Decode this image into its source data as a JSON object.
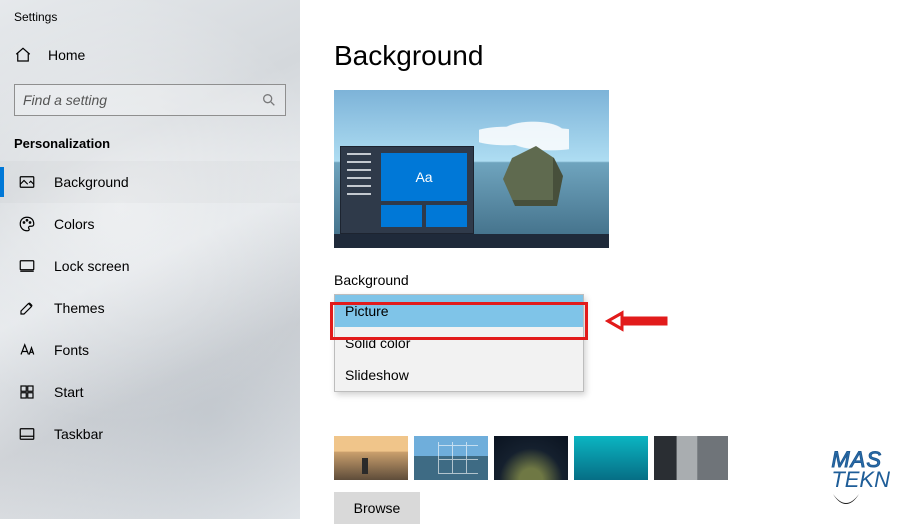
{
  "window_title": "Settings",
  "home_label": "Home",
  "search": {
    "placeholder": "Find a setting"
  },
  "section": "Personalization",
  "nav": [
    {
      "id": "background",
      "label": "Background",
      "active": true
    },
    {
      "id": "colors",
      "label": "Colors"
    },
    {
      "id": "lockscreen",
      "label": "Lock screen"
    },
    {
      "id": "themes",
      "label": "Themes"
    },
    {
      "id": "fonts",
      "label": "Fonts"
    },
    {
      "id": "start",
      "label": "Start"
    },
    {
      "id": "taskbar",
      "label": "Taskbar"
    }
  ],
  "page": {
    "title": "Background",
    "preview_tile_text": "Aa",
    "dropdown_label": "Background",
    "options": [
      {
        "value": "picture",
        "label": "Picture",
        "selected": true
      },
      {
        "value": "solid",
        "label": "Solid color"
      },
      {
        "value": "slideshow",
        "label": "Slideshow"
      }
    ],
    "browse_label": "Browse"
  },
  "annotation": {
    "highlight_color": "#e21b1b"
  },
  "watermark": {
    "line1": "MAS",
    "line2": "TEKN"
  }
}
